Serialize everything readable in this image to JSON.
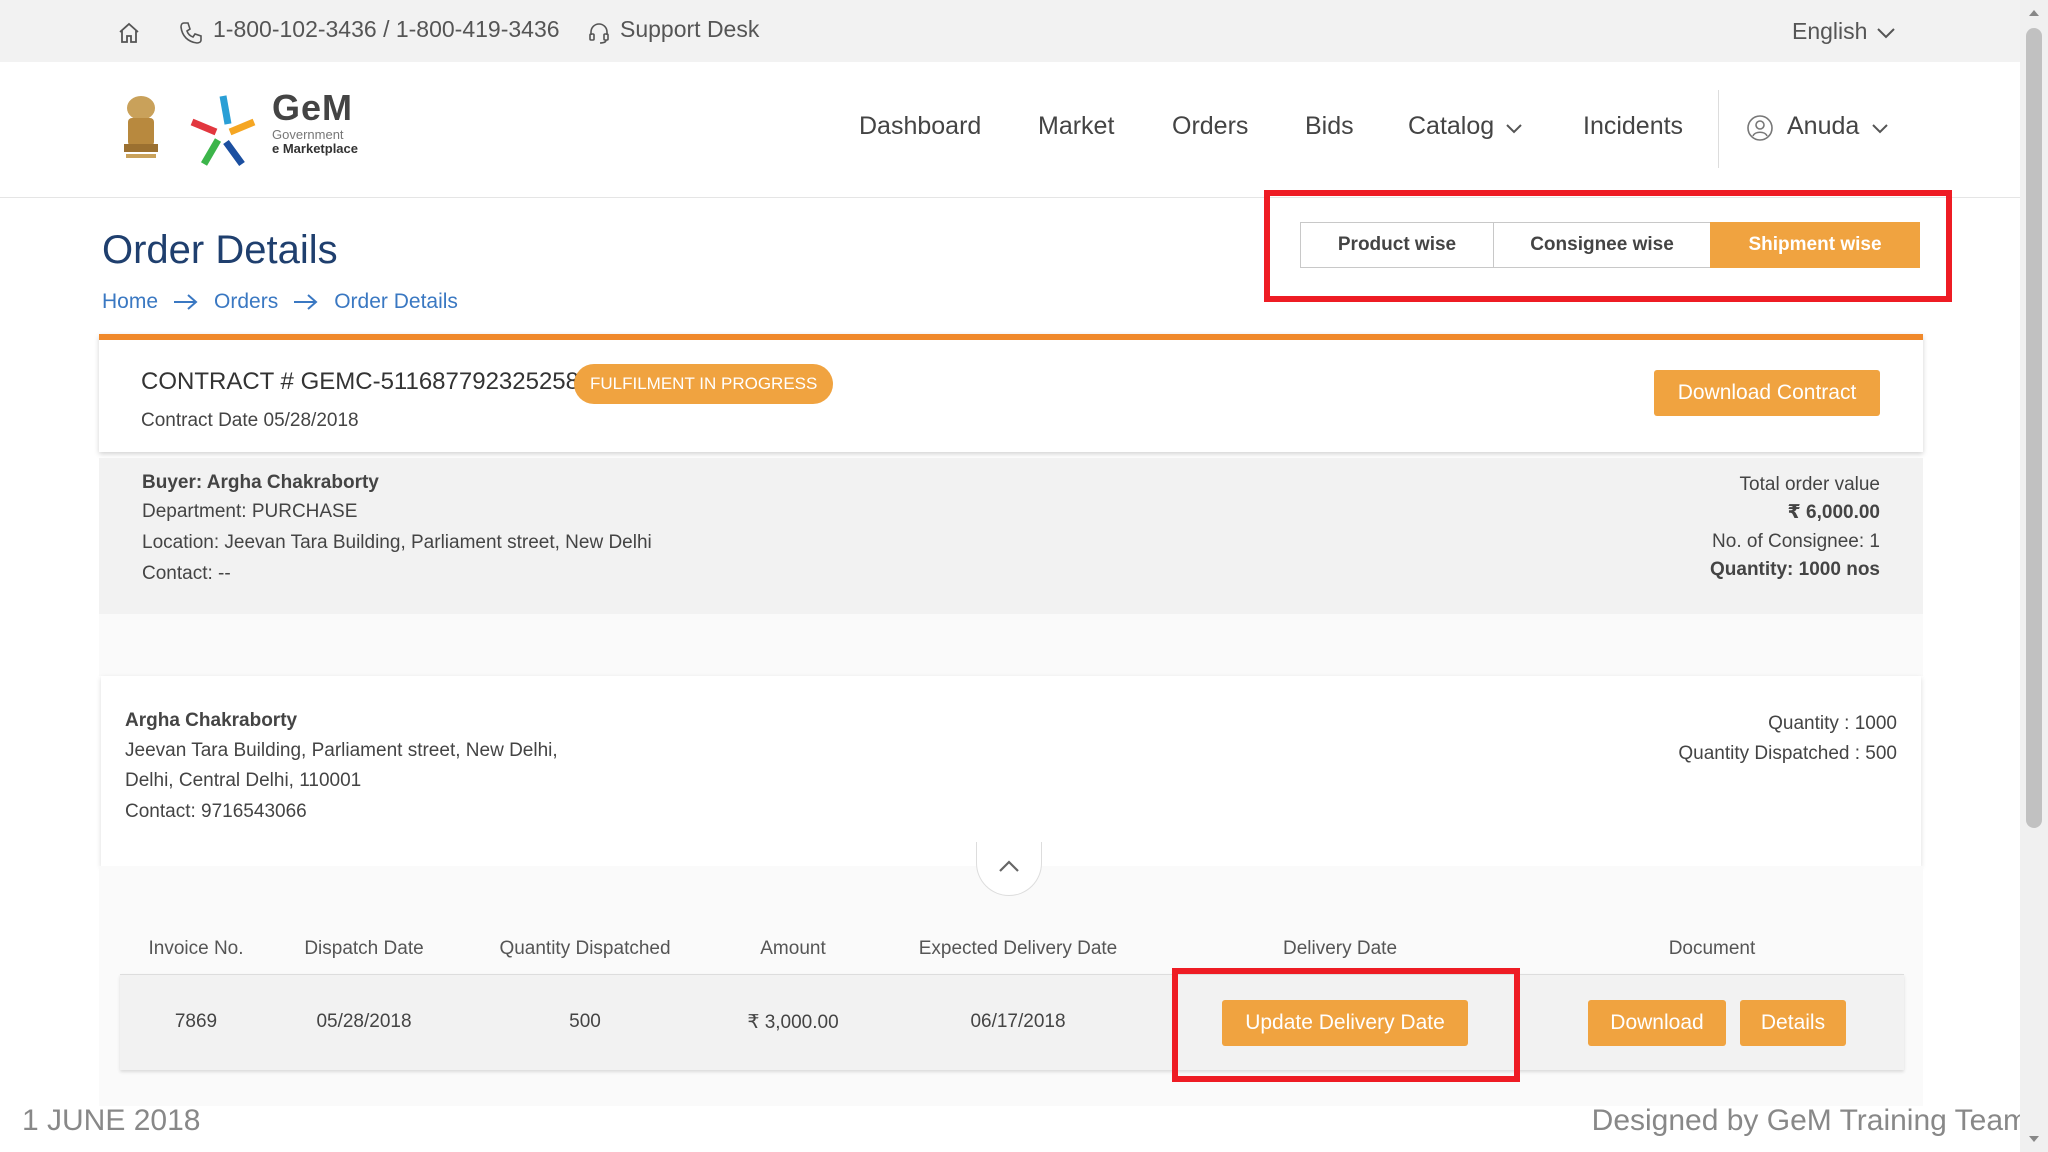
{
  "topbar": {
    "phone": "1-800-102-3436 / 1-800-419-3436",
    "support": "Support Desk",
    "language": "English"
  },
  "logo": {
    "brand": "GeM",
    "line1": "Government",
    "line2": "e Marketplace"
  },
  "nav": {
    "items": [
      "Dashboard",
      "Market",
      "Orders",
      "Bids",
      "Catalog",
      "Incidents"
    ],
    "user": "Anuda"
  },
  "page": {
    "title": "Order Details",
    "breadcrumb": [
      "Home",
      "Orders",
      "Order Details"
    ]
  },
  "view_toggle": {
    "options": [
      "Product wise",
      "Consignee wise",
      "Shipment wise"
    ],
    "active": "Shipment wise"
  },
  "contract": {
    "number": "CONTRACT # GEMC-511687792325258",
    "status": "FULFILMENT IN PROGRESS",
    "date": "Contract Date 05/28/2018",
    "download_label": "Download Contract"
  },
  "buyer": {
    "name": "Buyer: Argha Chakraborty",
    "department": "Department: PURCHASE",
    "location": "Location: Jeevan Tara Building, Parliament street, New Delhi",
    "contact": "Contact: --"
  },
  "order_summary": {
    "total_label": "Total order value",
    "total_value": "₹ 6,000.00",
    "consignee_count": "No. of Consignee: 1",
    "quantity": "Quantity: 1000 nos"
  },
  "consignee": {
    "name": "Argha Chakraborty",
    "address1": "Jeevan Tara Building, Parliament street, New Delhi,",
    "address2": "Delhi, Central Delhi, 110001",
    "contact": "Contact: 9716543066",
    "quantity": "Quantity : 1000",
    "dispatched": "Quantity Dispatched : 500"
  },
  "shipments": {
    "headers": [
      "Invoice No.",
      "Dispatch Date",
      "Quantity Dispatched",
      "Amount",
      "Expected Delivery Date",
      "Delivery Date",
      "Document"
    ],
    "rows": [
      {
        "invoice": "7869",
        "dispatch_date": "05/28/2018",
        "quantity": "500",
        "amount": "₹ 3,000.00",
        "expected_delivery": "06/17/2018",
        "update_label": "Update Delivery Date",
        "download_label": "Download",
        "details_label": "Details"
      }
    ]
  },
  "footer": {
    "date": "1 JUNE 2018",
    "credit": "Designed by GeM Training Team"
  },
  "colors": {
    "accent_orange": "#f0a340",
    "top_border_orange": "#f0892b",
    "highlight_red": "#ee1c24",
    "title_blue": "#1f3f6e",
    "link_blue": "#3a78c2"
  }
}
